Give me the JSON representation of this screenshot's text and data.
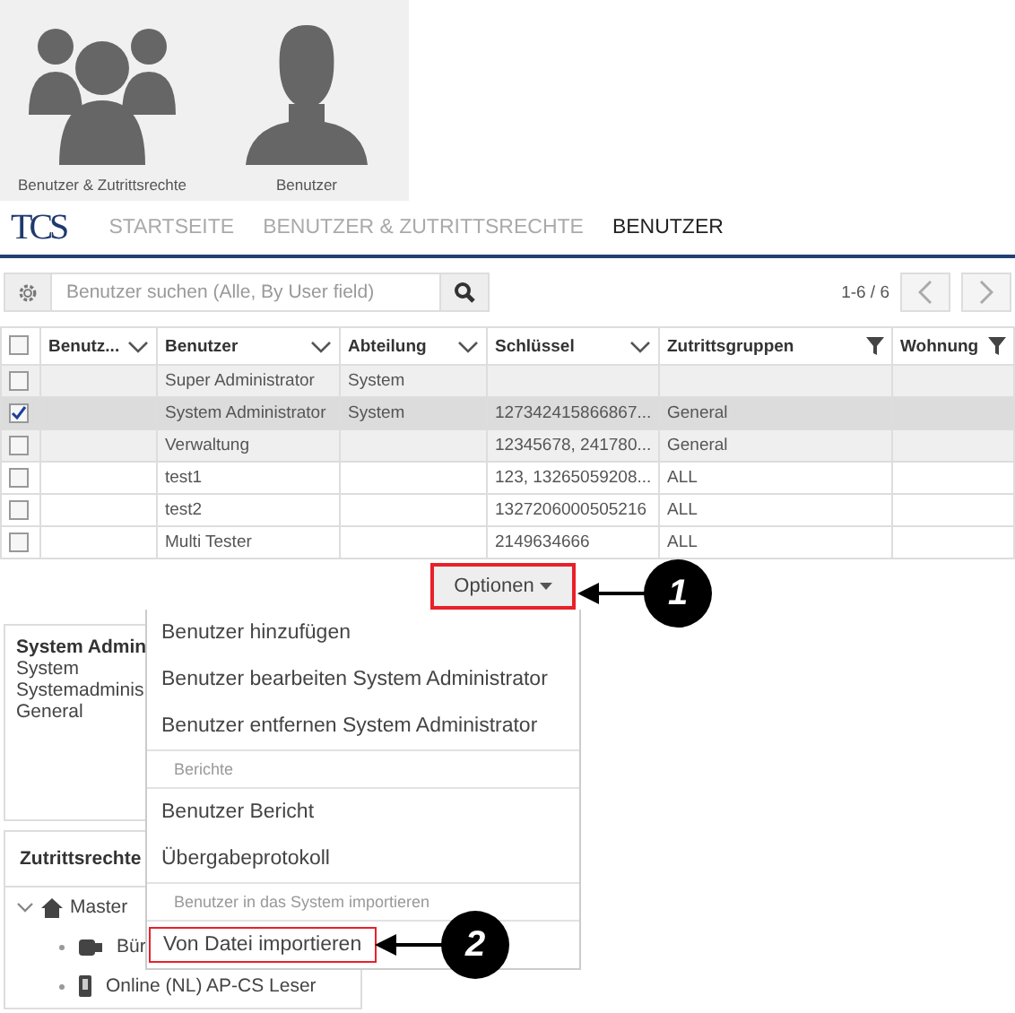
{
  "tiles": [
    {
      "label": "Benutzer & Zutrittsrechte",
      "kind": "group"
    },
    {
      "label": "Benutzer",
      "kind": "person"
    }
  ],
  "nav": {
    "logo": "TCS",
    "items": [
      {
        "label": "STARTSEITE",
        "selected": false
      },
      {
        "label": "BENUTZER & ZUTRITTSRECHTE",
        "selected": false
      },
      {
        "label": "BENUTZER",
        "selected": true
      }
    ]
  },
  "search": {
    "placeholder": "Benutzer suchen (Alle, By User field)"
  },
  "pager": {
    "range": "1-6 / 6"
  },
  "table": {
    "select_all_checked": false,
    "columns": [
      {
        "label": "Benutz...",
        "kind": "sort"
      },
      {
        "label": "Benutzer",
        "kind": "sort"
      },
      {
        "label": "Abteilung",
        "kind": "sort"
      },
      {
        "label": "Schlüssel",
        "kind": "sort"
      },
      {
        "label": "Zutrittsgruppen",
        "kind": "filter"
      },
      {
        "label": "Wohnung",
        "kind": "filter"
      }
    ],
    "rows": [
      {
        "checked": false,
        "shaded": true,
        "cells": [
          "",
          "Super Administrator",
          "System",
          "",
          "",
          ""
        ]
      },
      {
        "checked": true,
        "shaded": true,
        "cells": [
          "",
          "System Administrator",
          "System",
          "127342415866867...",
          "General",
          ""
        ]
      },
      {
        "checked": false,
        "shaded": true,
        "cells": [
          "",
          "Verwaltung",
          "",
          "12345678, 241780...",
          "General",
          ""
        ]
      },
      {
        "checked": false,
        "shaded": false,
        "cells": [
          "",
          "test1",
          "",
          "123, 13265059208...",
          "ALL",
          ""
        ]
      },
      {
        "checked": false,
        "shaded": false,
        "cells": [
          "",
          "test2",
          "",
          "1327206000505216",
          "ALL",
          ""
        ]
      },
      {
        "checked": false,
        "shaded": false,
        "cells": [
          "",
          "Multi Tester",
          "",
          "2149634666",
          "ALL",
          ""
        ]
      }
    ]
  },
  "options_button": {
    "label": "Optionen",
    "highlighted": true
  },
  "callouts": [
    {
      "number": "1"
    },
    {
      "number": "2"
    }
  ],
  "details": {
    "title": "System Admin",
    "lines": [
      "System",
      "Systemadminis",
      "General"
    ]
  },
  "access_panel": {
    "title": "Zutrittsrechte",
    "tree": [
      {
        "label": "Master",
        "kind": "home",
        "expanded": true,
        "children": [
          {
            "label": "Bür",
            "kind": "controller"
          },
          {
            "label": "Online (NL) AP-CS Leser",
            "kind": "reader"
          }
        ]
      }
    ]
  },
  "menu": [
    {
      "kind": "item",
      "label": "Benutzer hinzufügen",
      "highlighted": false
    },
    {
      "kind": "item",
      "label": "Benutzer bearbeiten System Administrator",
      "highlighted": false
    },
    {
      "kind": "item",
      "label": "Benutzer entfernen System Administrator",
      "highlighted": false
    },
    {
      "kind": "header",
      "label": "Berichte"
    },
    {
      "kind": "item",
      "label": "Benutzer Bericht",
      "highlighted": false
    },
    {
      "kind": "item",
      "label": "Übergabeprotokoll",
      "highlighted": false
    },
    {
      "kind": "header",
      "label": "Benutzer in das System importieren"
    },
    {
      "kind": "item",
      "label": "Von Datei importieren",
      "highlighted": true
    }
  ]
}
